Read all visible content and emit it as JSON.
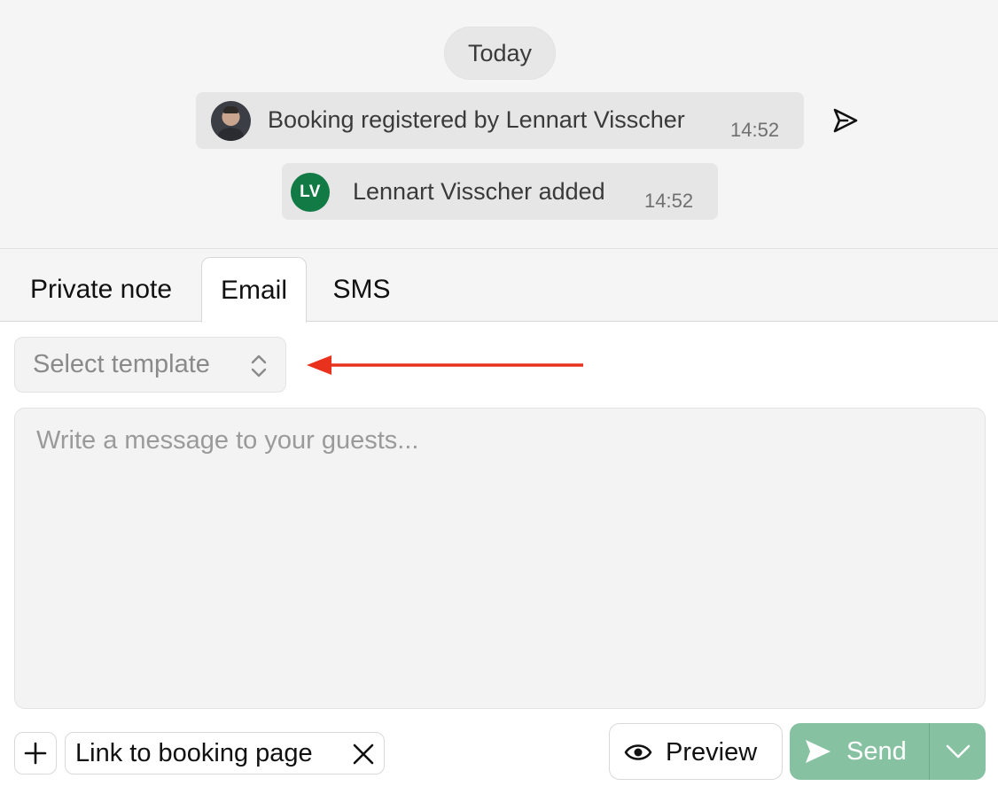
{
  "timeline": {
    "date_label": "Today",
    "events": [
      {
        "text": "Booking registered by Lennart Visscher",
        "time": "14:52",
        "avatar": "photo",
        "status_icon": "sent-icon"
      },
      {
        "text": "Lennart Visscher added",
        "time": "14:52",
        "avatar_initials": "LV",
        "avatar_color": "#127a44"
      }
    ]
  },
  "composer": {
    "tabs": [
      {
        "label": "Private note",
        "active": false
      },
      {
        "label": "Email",
        "active": true
      },
      {
        "label": "SMS",
        "active": false
      }
    ],
    "template_select": {
      "placeholder": "Select template",
      "icon": "chevron-updown-icon"
    },
    "message": {
      "placeholder": "Write a message to your guests...",
      "value": ""
    },
    "attachments": {
      "add_icon": "plus-icon",
      "chips": [
        {
          "label": "Link to booking page",
          "remove_icon": "x-icon"
        }
      ]
    },
    "actions": {
      "preview_label": "Preview",
      "preview_icon": "eye-icon",
      "send_label": "Send",
      "send_icon": "send-plane-icon",
      "send_dropdown_icon": "chevron-down-icon",
      "send_color": "#86c2a1"
    }
  },
  "annotation": {
    "arrow_color": "#e8321e",
    "points_to": "template_select"
  }
}
